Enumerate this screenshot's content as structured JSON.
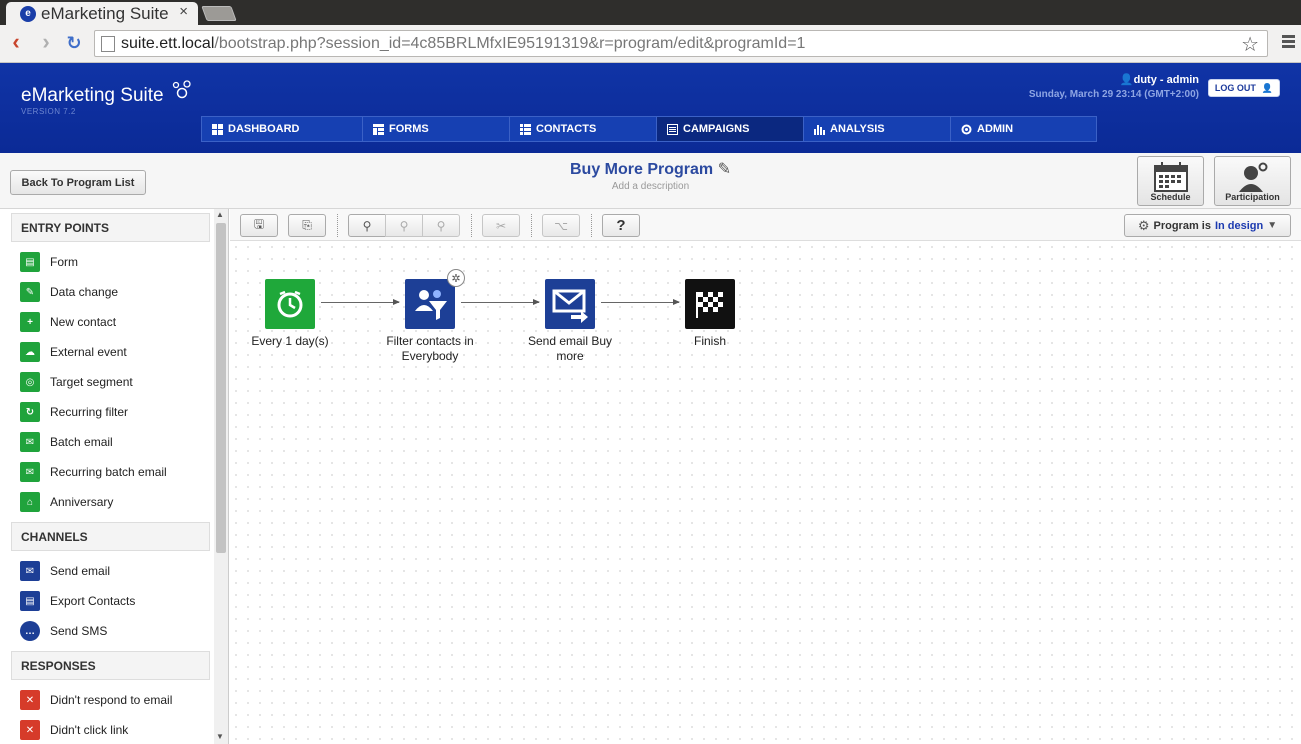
{
  "browser": {
    "tab_title": "eMarketing Suite",
    "tab_close": "×",
    "url_host": "suite.ett.local",
    "url_path": "/bootstrap.php?session_id=4c85BRLMfxIE95191319&r=program/edit&programId=1"
  },
  "header": {
    "logo": "eMarketing Suite",
    "version": "VERSION 7.2",
    "user": "duty - admin",
    "datetime": "Sunday, March 29 23:14 (GMT+2:00)",
    "logout": "LOG OUT",
    "nav": [
      {
        "label": "DASHBOARD",
        "icon": "dashboard-icon"
      },
      {
        "label": "FORMS",
        "icon": "forms-icon"
      },
      {
        "label": "CONTACTS",
        "icon": "contacts-icon"
      },
      {
        "label": "CAMPAIGNS",
        "icon": "campaigns-icon",
        "active": true
      },
      {
        "label": "ANALYSIS",
        "icon": "analysis-icon"
      },
      {
        "label": "ADMIN",
        "icon": "admin-icon"
      }
    ]
  },
  "program": {
    "back": "Back To Program List",
    "title": "Buy More Program",
    "description": "Add a description",
    "schedule": "Schedule",
    "participation": "Participation",
    "status_prefix": "Program is",
    "status_value": "In design"
  },
  "sidebar": {
    "entry_title": "ENTRY POINTS",
    "entry": [
      "Form",
      "Data change",
      "New contact",
      "External event",
      "Target segment",
      "Recurring filter",
      "Batch email",
      "Recurring batch email",
      "Anniversary"
    ],
    "channels_title": "CHANNELS",
    "channels": [
      "Send email",
      "Export Contacts",
      "Send SMS"
    ],
    "responses_title": "RESPONSES",
    "responses": [
      "Didn't respond to email",
      "Didn't click link"
    ]
  },
  "workflow": {
    "nodes": [
      {
        "label": "Every 1 day(s)",
        "color": "#1fa83a"
      },
      {
        "label": "Filter contacts in Everybody",
        "color": "#1d3f96"
      },
      {
        "label": "Send email Buy more",
        "color": "#1d3f96"
      },
      {
        "label": "Finish",
        "color": "#111111"
      }
    ]
  },
  "toolbar": {
    "help": "?"
  },
  "colors": {
    "brand": "#0b2a96",
    "accent_green": "#20a33c",
    "accent_red": "#d63b2a"
  }
}
